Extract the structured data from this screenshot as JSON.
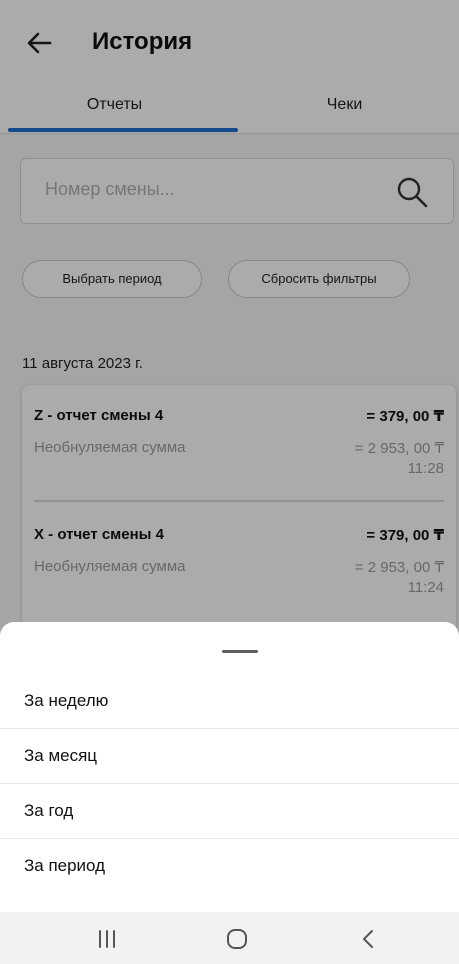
{
  "header": {
    "title": "История"
  },
  "tabs": [
    {
      "label": "Отчеты"
    },
    {
      "label": "Чеки"
    }
  ],
  "search": {
    "placeholder": "Номер смены..."
  },
  "filters": {
    "select_period": "Выбрать период",
    "reset_filters": "Сбросить фильтры"
  },
  "date_group": "11 августа 2023 г.",
  "reports": [
    {
      "name": "Z - отчет смены 4",
      "amount": "= 379, 00 ₸",
      "sub_label": "Необнуляемая сумма",
      "sub_amount": "= 2 953, 00 ₸",
      "time": "11:28"
    },
    {
      "name": "X - отчет смены 4",
      "amount": "= 379, 00 ₸",
      "sub_label": "Необнуляемая сумма",
      "sub_amount": "= 2 953, 00 ₸",
      "time": "11:24"
    }
  ],
  "sheet": {
    "options": [
      {
        "label": "За неделю"
      },
      {
        "label": "За месяц"
      },
      {
        "label": "За год"
      },
      {
        "label": "За период"
      }
    ]
  },
  "colors": {
    "accent": "#1e6fd1"
  }
}
